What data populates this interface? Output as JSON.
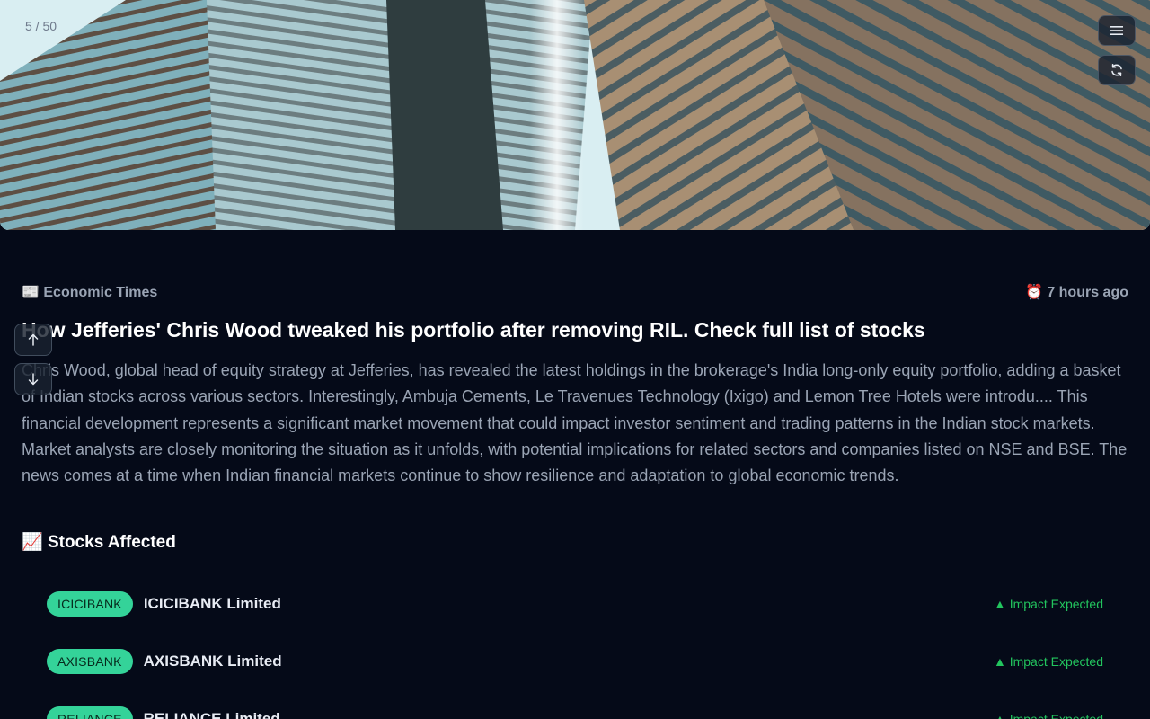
{
  "header": {
    "counter": "5 / 50",
    "menu_icon": "hamburger-menu-icon",
    "refresh_icon": "refresh-icon"
  },
  "navigation": {
    "up_icon": "arrow-up-icon",
    "down_icon": "arrow-down-icon"
  },
  "article": {
    "source_icon": "📰",
    "source": "Economic Times",
    "time_icon": "⏰",
    "time": "7 hours ago",
    "headline": "How Jefferies' Chris Wood tweaked his portfolio after removing RIL. Check full list of stocks",
    "summary": "Chris Wood, global head of equity strategy at Jefferies, has revealed the latest holdings in the brokerage's India long-only equity portfolio, adding a basket of Indian stocks across various sectors. Interestingly, Ambuja Cements, Le Travenues Technology (Ixigo) and Lemon Tree Hotels were introdu.... This financial development represents a significant market movement that could impact investor sentiment and trading patterns in the Indian stock markets. Market analysts are closely monitoring the situation as it unfolds, with potential implications for related sectors and companies listed on NSE and BSE. The news comes at a time when Indian financial markets continue to show resilience and adaptation to global economic trends."
  },
  "stocks": {
    "title_icon": "📈",
    "title": "Stocks Affected",
    "items": [
      {
        "ticker": "ICICIBANK",
        "name": "ICICIBANK Limited",
        "impact": "▲ Impact Expected"
      },
      {
        "ticker": "AXISBANK",
        "name": "AXISBANK Limited",
        "impact": "▲ Impact Expected"
      },
      {
        "ticker": "RELIANCE",
        "name": "RELIANCE Limited",
        "impact": "▲ Impact Expected"
      }
    ]
  },
  "colors": {
    "background": "#050a18",
    "ticker_badge": "#34d399",
    "impact_positive": "#22c55e"
  }
}
